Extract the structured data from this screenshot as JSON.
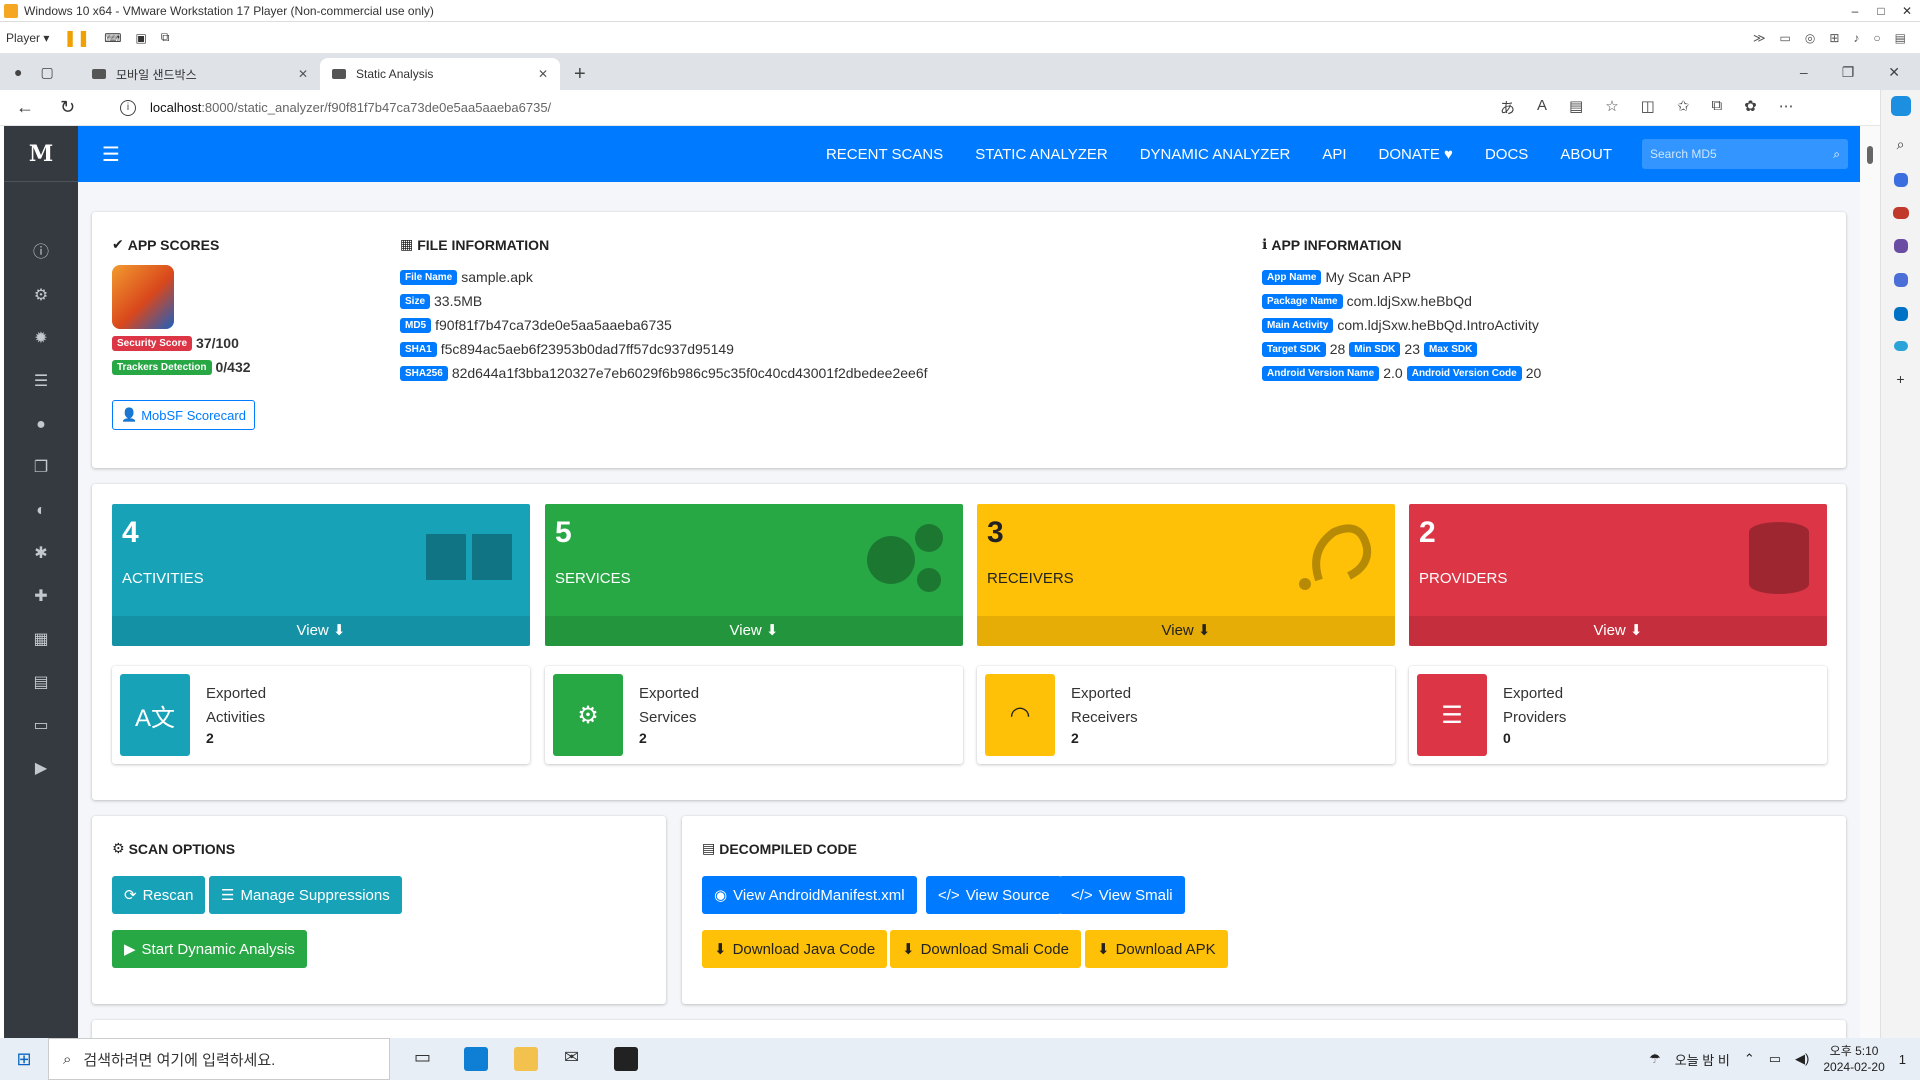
{
  "vm": {
    "title": "Windows 10 x64 - VMware Workstation 17 Player (Non-commercial use only)",
    "player_label": "Player ▾",
    "min": "–",
    "max": "□",
    "close": "✕"
  },
  "browser": {
    "tabs": [
      {
        "label": "모바일 샌드박스",
        "close": "✕"
      },
      {
        "label": "Static Analysis",
        "close": "✕"
      }
    ],
    "new_tab": "+",
    "url_host": "localhost",
    "url_path": ":8000/static_analyzer/f90f81f7b47ca73de0e5aa5aaeba6735/"
  },
  "nav": {
    "links": [
      "RECENT SCANS",
      "STATIC ANALYZER",
      "DYNAMIC ANALYZER",
      "API",
      "DONATE ♥",
      "DOCS",
      "ABOUT"
    ],
    "search_placeholder": "Search MD5"
  },
  "app_scores": {
    "title": "APP SCORES",
    "security_label": "Security Score",
    "security_value": "37/100",
    "trackers_label": "Trackers Detection",
    "trackers_value": "0/432",
    "scorecard_button": "MobSF Scorecard"
  },
  "file_info": {
    "title": "FILE INFORMATION",
    "file_name_label": "File Name",
    "file_name": "sample.apk",
    "size_label": "Size",
    "size": "33.5MB",
    "md5_label": "MD5",
    "md5": "f90f81f7b47ca73de0e5aa5aaeba6735",
    "sha1_label": "SHA1",
    "sha1": "f5c894ac5aeb6f23953b0dad7ff57dc937d95149",
    "sha256_label": "SHA256",
    "sha256": "82d644a1f3bba120327e7eb6029f6b986c95c35f0c40cd43001f2dbedee2ee6f"
  },
  "app_info": {
    "title": "APP INFORMATION",
    "app_name_label": "App Name",
    "app_name": "My Scan APP",
    "package_label": "Package Name",
    "package": "com.ldjSxw.heBbQd",
    "main_activity_label": "Main Activity",
    "main_activity": "com.ldjSxw.heBbQd.IntroActivity",
    "target_sdk_label": "Target SDK",
    "target_sdk": "28",
    "min_sdk_label": "Min SDK",
    "min_sdk": "23",
    "max_sdk_label": "Max SDK",
    "version_name_label": "Android Version Name",
    "version_name": "2.0",
    "version_code_label": "Android Version Code",
    "version_code": "20"
  },
  "stats": [
    {
      "count": "4",
      "label": "ACTIVITIES",
      "view": "View",
      "color": "#17a2b8"
    },
    {
      "count": "5",
      "label": "SERVICES",
      "view": "View",
      "color": "#28a745"
    },
    {
      "count": "3",
      "label": "RECEIVERS",
      "view": "View",
      "color": "#ffc107"
    },
    {
      "count": "2",
      "label": "PROVIDERS",
      "view": "View",
      "color": "#dc3545"
    }
  ],
  "exported": [
    {
      "line1": "Exported",
      "line2": "Activities",
      "value": "2"
    },
    {
      "line1": "Exported",
      "line2": "Services",
      "value": "2"
    },
    {
      "line1": "Exported",
      "line2": "Receivers",
      "value": "2"
    },
    {
      "line1": "Exported",
      "line2": "Providers",
      "value": "0"
    }
  ],
  "scan_options": {
    "title": "SCAN OPTIONS",
    "rescan": "Rescan",
    "manage_suppressions": "Manage Suppressions",
    "start_dynamic": "Start Dynamic Analysis"
  },
  "decompiled": {
    "title": "DECOMPILED CODE",
    "view_manifest": "View AndroidManifest.xml",
    "view_source": "View Source",
    "view_smali": "View Smali",
    "download_java": "Download Java Code",
    "download_smali": "Download Smali Code",
    "download_apk": "Download APK"
  },
  "taskbar": {
    "search_placeholder": "검색하려면 여기에 입력하세요.",
    "weather": "오늘 밤 비",
    "time": "오후 5:10",
    "date": "2024-02-20",
    "notif": "1"
  }
}
